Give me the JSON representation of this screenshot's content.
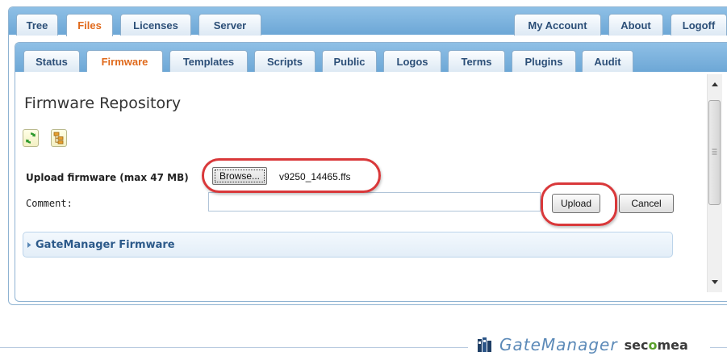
{
  "top_tabs": [
    {
      "label": "Tree",
      "active": false
    },
    {
      "label": "Files",
      "active": true
    },
    {
      "label": "Licenses",
      "active": false
    },
    {
      "label": "Server",
      "active": false
    },
    {
      "label": "My Account",
      "active": false
    },
    {
      "label": "About",
      "active": false
    },
    {
      "label": "Logoff",
      "active": false
    }
  ],
  "sub_tabs": [
    {
      "label": "Status",
      "active": false
    },
    {
      "label": "Firmware",
      "active": true
    },
    {
      "label": "Templates",
      "active": false
    },
    {
      "label": "Scripts",
      "active": false
    },
    {
      "label": "Public",
      "active": false
    },
    {
      "label": "Logos",
      "active": false
    },
    {
      "label": "Terms",
      "active": false
    },
    {
      "label": "Plugins",
      "active": false
    },
    {
      "label": "Audit",
      "active": false
    }
  ],
  "page": {
    "title": "Firmware Repository",
    "toolbar_icons": [
      "refresh-icon",
      "tree-view-icon"
    ]
  },
  "upload": {
    "label": "Upload firmware (max 47 MB)",
    "browse_label": "Browse...",
    "selected_file": "v9250_14465.ffs",
    "comment_label": "Comment:",
    "comment_value": "",
    "upload_label": "Upload",
    "cancel_label": "Cancel"
  },
  "section": {
    "title": "GateManager Firmware",
    "expanded": false
  },
  "branding": {
    "product": "GateManager",
    "company_prefix": "sec",
    "company_accent": "o",
    "company_suffix": "mea"
  },
  "colors": {
    "tab_bar": "#7fb5e0",
    "active_tab_text": "#e06a1c",
    "highlight": "#d9383a"
  }
}
